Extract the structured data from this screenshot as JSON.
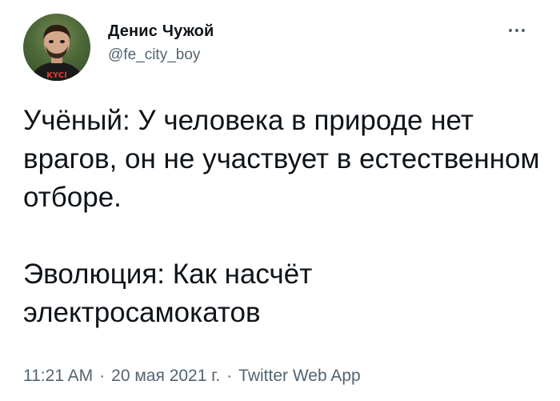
{
  "author": {
    "display_name": "Денис Чужой",
    "handle": "@fe_city_boy",
    "avatar_text": "KYCI"
  },
  "tweet": {
    "paragraphs": [
      "Учёный: У человека в природе нет врагов, он не участвует в естественном отборе.",
      "Эволюция: Как насчёт электросамокатов"
    ]
  },
  "meta": {
    "time": "11:21 AM",
    "separator": "·",
    "date": "20 мая 2021 г.",
    "source": "Twitter Web App"
  },
  "icons": {
    "more": "more-horizontal-icon"
  }
}
